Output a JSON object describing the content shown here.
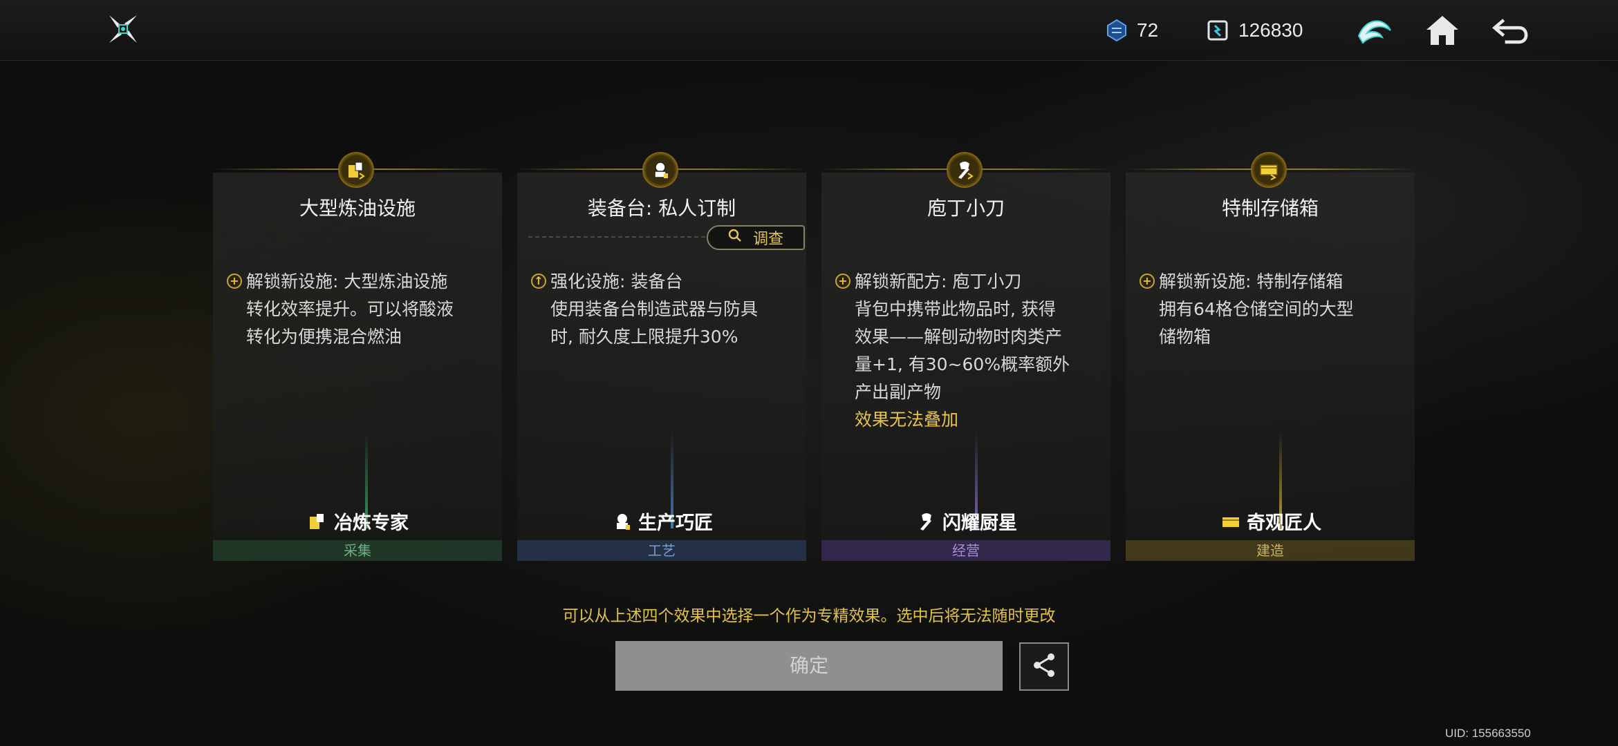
{
  "topbar": {
    "logo_icon": "shuriken-logo-icon",
    "resources": [
      {
        "icon": "crystal-currency-icon",
        "value": "72"
      },
      {
        "icon": "coin-currency-icon",
        "value": "126830"
      }
    ],
    "buttons": [
      "emblem-icon",
      "home-icon",
      "back-arrow-icon"
    ]
  },
  "cards": [
    {
      "title": "大型炼油设施",
      "body": [
        "解锁新设施: 大型炼油设施",
        "转化效率提升。可以将酸液",
        "转化为便携混合燃油"
      ],
      "warning": "",
      "role": "冶炼专家",
      "category": "采集",
      "accent": "#3aa56a"
    },
    {
      "title": "装备台: 私人订制",
      "body": [
        "强化设施: 装备台",
        "使用装备台制造武器与防具",
        "时, 耐久度上限提升30%"
      ],
      "warning": "",
      "role": "生产巧匠",
      "category": "工艺",
      "accent": "#4f7fc4",
      "investigate_label": "调查"
    },
    {
      "title": "庖丁小刀",
      "body": [
        "解锁新配方: 庖丁小刀",
        "背包中携带此物品时, 获得",
        "效果——解刨动物时肉类产",
        "量+1, 有30~60%概率额外",
        "产出副产物"
      ],
      "warning": "效果无法叠加",
      "role": "闪耀厨星",
      "category": "经营",
      "accent": "#8a6bc8"
    },
    {
      "title": "特制存储箱",
      "body": [
        "解锁新设施: 特制存储箱",
        "拥有64格仓储空间的大型",
        "储物箱"
      ],
      "warning": "",
      "role": "奇观匠人",
      "category": "建造",
      "accent": "#c8a830"
    }
  ],
  "hint": "可以从上述四个效果中选择一个作为专精效果。选中后将无法随时更改",
  "confirm_label": "确定",
  "uid": "UID: 155663550",
  "colors": {
    "gold": "#e3c24c",
    "confirm_bg": "#8f8f8f"
  }
}
